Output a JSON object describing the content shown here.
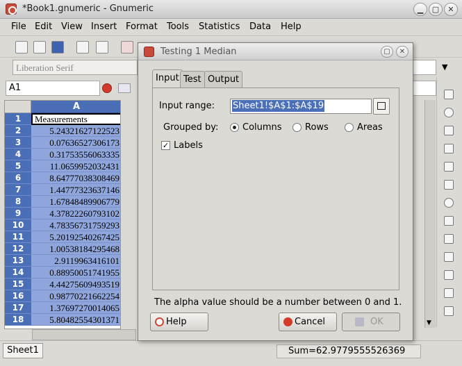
{
  "window": {
    "title": "*Book1.gnumeric - Gnumeric",
    "controls": [
      "▁",
      "▢",
      "✕"
    ]
  },
  "menu": [
    "File",
    "Edit",
    "View",
    "Insert",
    "Format",
    "Tools",
    "Statistics",
    "Data",
    "Help"
  ],
  "format_bar": {
    "font": "Liberation Serif"
  },
  "edit_bar": {
    "cell_ref": "A1"
  },
  "sheet": {
    "column": "A",
    "rows": [
      {
        "num": "1",
        "value": "Measurements"
      },
      {
        "num": "2",
        "value": "5.24321627122523"
      },
      {
        "num": "3",
        "value": "0.07636527306173"
      },
      {
        "num": "4",
        "value": "0.31753556063335"
      },
      {
        "num": "5",
        "value": "11.0659952032431"
      },
      {
        "num": "6",
        "value": "8.64777038308469"
      },
      {
        "num": "7",
        "value": "1.44777323637146"
      },
      {
        "num": "8",
        "value": "1.67848489906779"
      },
      {
        "num": "9",
        "value": "4.37822260793102"
      },
      {
        "num": "10",
        "value": "4.78356731759293"
      },
      {
        "num": "11",
        "value": "5.20192540267425"
      },
      {
        "num": "12",
        "value": "1.00538184295468"
      },
      {
        "num": "13",
        "value": "2.9119963416101"
      },
      {
        "num": "14",
        "value": "0.88950051741955"
      },
      {
        "num": "15",
        "value": "4.44275609493519"
      },
      {
        "num": "16",
        "value": "0.98770221662254"
      },
      {
        "num": "17",
        "value": "1.37697270014065"
      },
      {
        "num": "18",
        "value": "5.80482554301371"
      }
    ],
    "tab": "Sheet1"
  },
  "status": {
    "sum": "Sum=62.9779555526369"
  },
  "dialog": {
    "title": "Testing 1 Median",
    "tabs": [
      "Input",
      "Test",
      "Output"
    ],
    "input_range_label": "Input range:",
    "input_range_value": "Sheet1!$A$1:$A$19",
    "grouped_by_label": "Grouped by:",
    "group_options": [
      "Columns",
      "Rows",
      "Areas"
    ],
    "labels_checkbox": "Labels",
    "message": "The alpha value should be a number between 0 and 1.",
    "help_button": "Help",
    "cancel_button": "Cancel",
    "ok_button": "OK"
  }
}
